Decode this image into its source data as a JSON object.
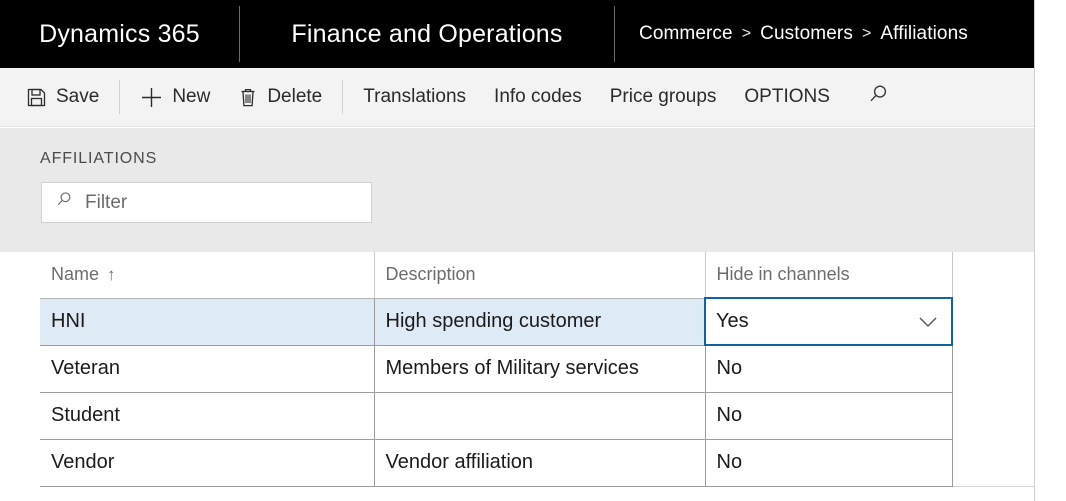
{
  "appbar": {
    "brand": "Dynamics 365",
    "module": "Finance and Operations",
    "breadcrumb": {
      "items": [
        "Commerce",
        "Customers",
        "Affiliations"
      ],
      "separator": ">"
    }
  },
  "toolbar": {
    "save_label": "Save",
    "save_icon": "floppy-disk-icon",
    "new_label": "New",
    "new_icon": "plus-icon",
    "delete_label": "Delete",
    "delete_icon": "trash-icon",
    "translations_label": "Translations",
    "info_codes_label": "Info codes",
    "price_groups_label": "Price groups",
    "options_label": "OPTIONS",
    "search_icon": "search-icon"
  },
  "page": {
    "title": "AFFILIATIONS"
  },
  "filter": {
    "icon": "search-icon",
    "value": "",
    "placeholder": "Filter"
  },
  "grid": {
    "columns": [
      {
        "label": "Name",
        "sort": "↑"
      },
      {
        "label": "Description",
        "sort": ""
      },
      {
        "label": "Hide in channels",
        "sort": ""
      }
    ],
    "rows": [
      {
        "name": "HNI",
        "description": "High spending customer",
        "hide_in_channels": "Yes",
        "selected": true,
        "focused_cell": "hide_in_channels",
        "dropdown_icon": "chevron-down-icon"
      },
      {
        "name": "Veteran",
        "description": "Members of Military services",
        "hide_in_channels": "No",
        "selected": false
      },
      {
        "name": "Student",
        "description": "",
        "hide_in_channels": "No",
        "selected": false
      },
      {
        "name": "Vendor",
        "description": "Vendor affiliation",
        "hide_in_channels": "No",
        "selected": false
      }
    ]
  },
  "colors": {
    "appbar_bg": "#000000",
    "toolbar_bg": "#f3f3f3",
    "panel_bg": "#e9e9e9",
    "row_selected_bg": "#deeaf6",
    "focus_border": "#12629e",
    "grid_line": "#9b9b9b"
  }
}
